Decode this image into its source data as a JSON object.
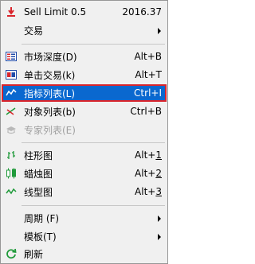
{
  "menu": {
    "sell_limit": {
      "label": "Sell Limit 0.5",
      "value": "2016.37",
      "icon": "sell-limit-arrow-icon"
    },
    "trade": {
      "label": "交易",
      "icon": "none"
    },
    "market_depth": {
      "label": "市场深度(D)",
      "shortcut": "Alt+B",
      "icon": "market-depth-icon"
    },
    "one_click": {
      "label": "单击交易(k)",
      "shortcut": "Alt+T",
      "icon": "one-click-trade-icon"
    },
    "indicator_list": {
      "label": "指标列表(L)",
      "shortcut": "Ctrl+I",
      "icon": "indicator-list-icon"
    },
    "object_list": {
      "label": "对象列表(b)",
      "shortcut": "Ctrl+B",
      "icon": "object-list-icon"
    },
    "expert_list": {
      "label": "专家列表(E)",
      "icon": "expert-hat-icon"
    },
    "bar_chart": {
      "label": "柱形图",
      "shortcut_prefix": "Alt+",
      "shortcut_key": "1",
      "icon": "bar-chart-icon"
    },
    "candle_chart": {
      "label": "蜡烛图",
      "shortcut_prefix": "Alt+",
      "shortcut_key": "2",
      "icon": "candlestick-icon"
    },
    "line_chart": {
      "label": "线型图",
      "shortcut_prefix": "Alt+",
      "shortcut_key": "3",
      "icon": "line-chart-icon"
    },
    "period": {
      "label": "周期 (F)"
    },
    "template": {
      "label": "模板(T)"
    },
    "refresh": {
      "label": "刷新",
      "icon": "refresh-icon"
    }
  },
  "colors": {
    "selection_bg": "#0a68cf",
    "selection_outline": "#d9242b",
    "menu_bg": "#f0f0f0"
  }
}
